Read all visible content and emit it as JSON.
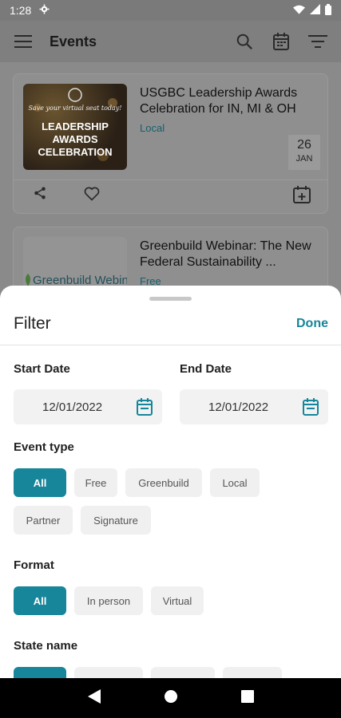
{
  "status_bar": {
    "time": "1:28"
  },
  "app_bar": {
    "title": "Events"
  },
  "events": [
    {
      "title": "USGBC Leadership Awards Celebration for IN, MI & OH",
      "tag": "Local",
      "day": "26",
      "month": "JAN",
      "image_text": {
        "line1": "Save your virtual seat today!",
        "line2": "LEADERSHIP AWARDS",
        "line3": "CELEBRATION"
      }
    },
    {
      "title": "Greenbuild Webinar: The New Federal Sustainability ...",
      "tag": "Free",
      "image_text": {
        "brand": "Greenbuild Webina"
      }
    }
  ],
  "filter": {
    "title": "Filter",
    "done_label": "Done",
    "start_date_label": "Start Date",
    "start_date_value": "12/01/2022",
    "end_date_label": "End Date",
    "end_date_value": "12/01/2022",
    "event_type_label": "Event type",
    "event_type_chips_row1": [
      "All",
      "Free",
      "Greenbuild",
      "Local"
    ],
    "event_type_chips_row2": [
      "Partner",
      "Signature"
    ],
    "format_label": "Format",
    "format_chips": [
      "All",
      "In person",
      "Virtual"
    ],
    "state_label": "State name"
  },
  "colors": {
    "accent": "#17859a",
    "tag": "#16606e"
  }
}
